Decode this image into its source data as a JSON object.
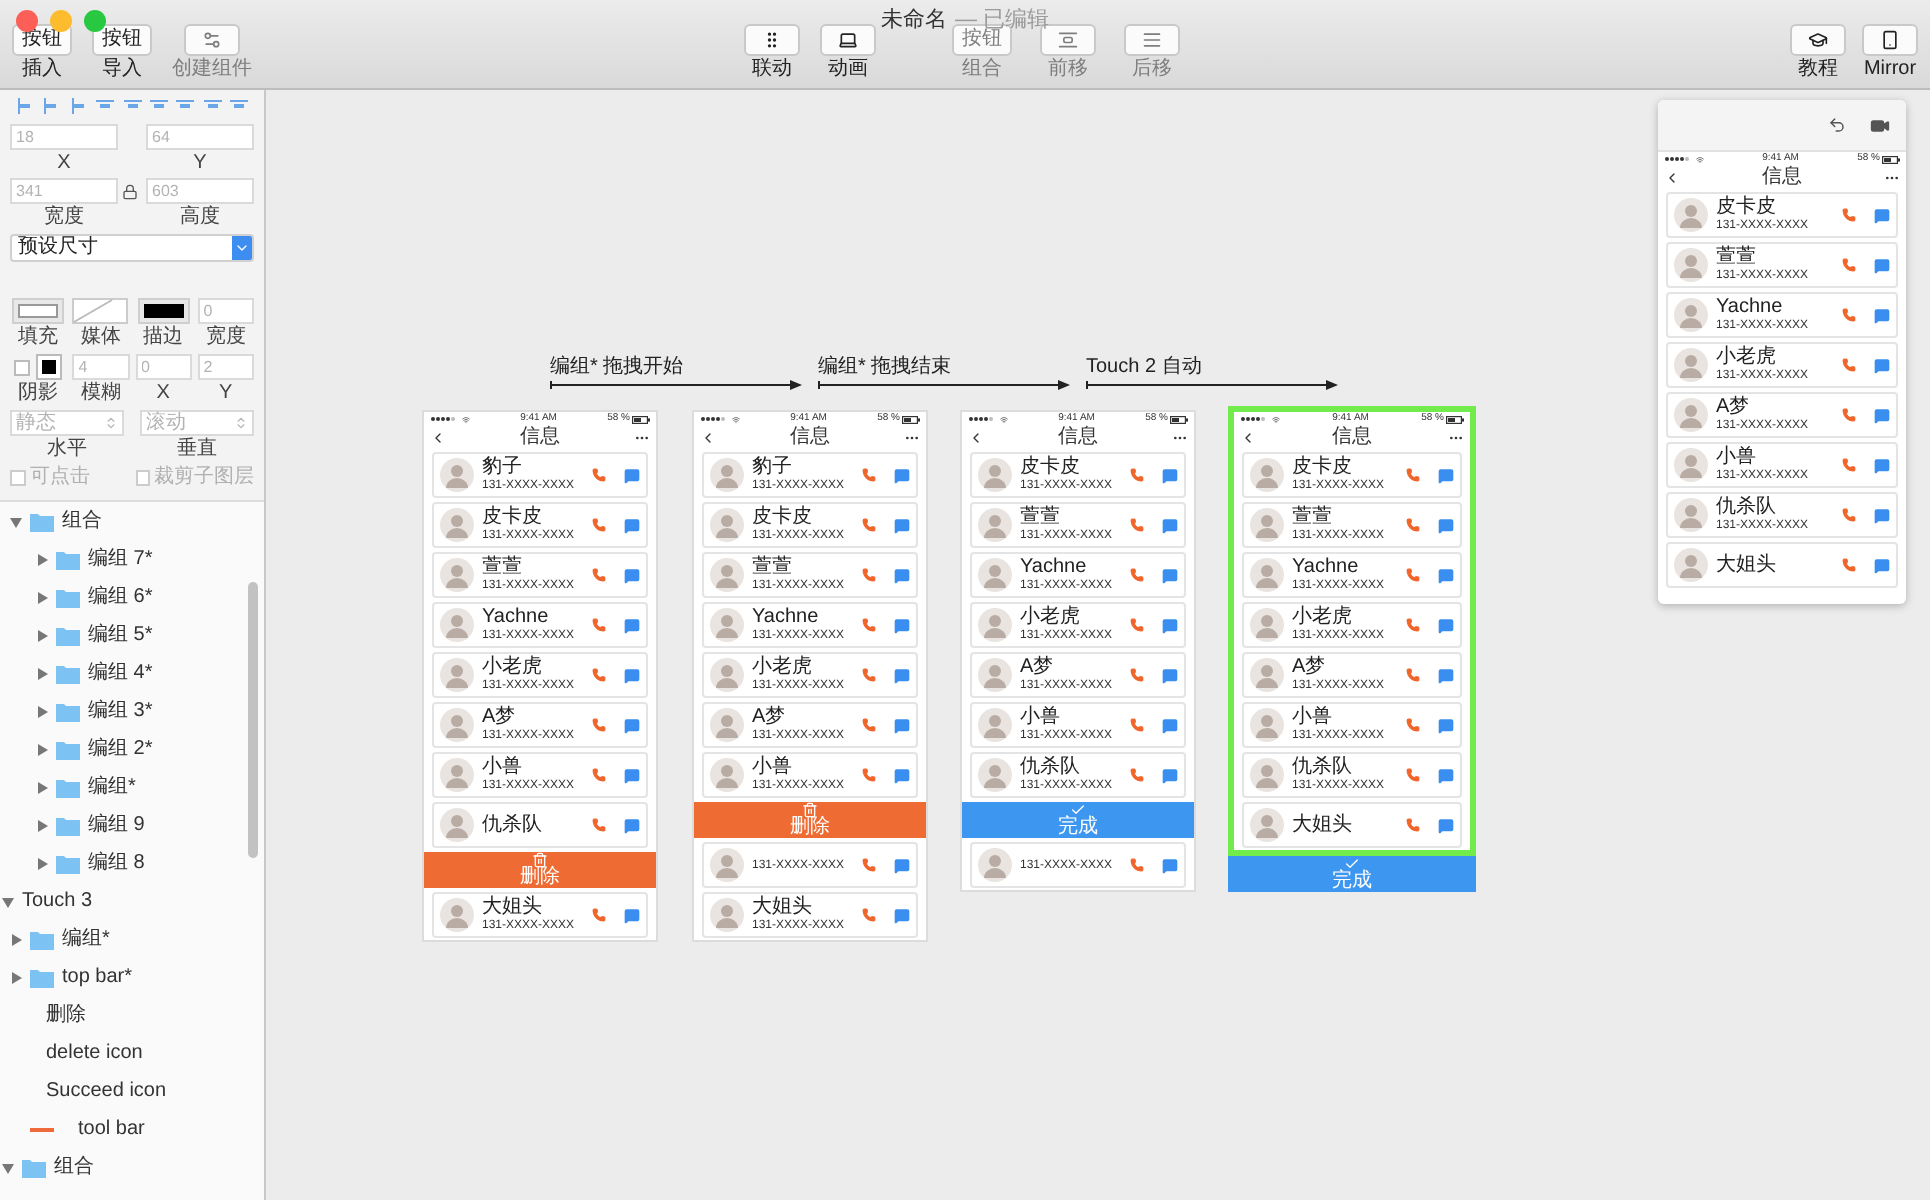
{
  "window": {
    "title": "未命名",
    "status": "— 已编辑"
  },
  "toolbar": {
    "left": [
      {
        "text": "按钮",
        "label": "插入",
        "disabled": false
      },
      {
        "text": "按钮",
        "label": "导入",
        "disabled": false
      },
      {
        "label": "创建组件",
        "disabled": true
      }
    ],
    "center": [
      {
        "label": "联动",
        "disabled": false
      },
      {
        "label": "动画",
        "disabled": false
      },
      {
        "text": "按钮",
        "label": "组合",
        "disabled": true
      },
      {
        "label": "前移",
        "disabled": true
      },
      {
        "label": "后移",
        "disabled": true
      }
    ],
    "right": [
      {
        "label": "教程",
        "disabled": false
      },
      {
        "label": "Mirror",
        "disabled": false
      }
    ]
  },
  "inspector": {
    "geometry": [
      {
        "value": "18",
        "label": "X"
      },
      {
        "value": "64",
        "label": "Y"
      },
      {
        "value": "341",
        "label": "宽度"
      },
      {
        "value": "603",
        "label": "高度"
      }
    ],
    "preset": "预设尺寸",
    "style_row": [
      {
        "kind": "fill",
        "label": "填充"
      },
      {
        "kind": "media",
        "label": "媒体"
      },
      {
        "kind": "stroke",
        "label": "描边"
      },
      {
        "kind": "number",
        "value": "0",
        "label": "宽度"
      }
    ],
    "shadow_row": [
      {
        "kind": "shadow",
        "label": "阴影",
        "checked": false
      },
      {
        "kind": "number",
        "value": "4",
        "label": "模糊"
      },
      {
        "kind": "number",
        "value": "0",
        "label": "X"
      },
      {
        "kind": "number",
        "value": "2",
        "label": "Y"
      }
    ],
    "position_row": [
      {
        "value": "静态",
        "label": "水平"
      },
      {
        "value": "滚动",
        "label": "垂直"
      }
    ],
    "options": [
      {
        "label": "可点击",
        "checked": false
      },
      {
        "label": "裁剪子图层",
        "checked": false
      }
    ]
  },
  "layers": [
    {
      "children": [
        {
          "label": "组合",
          "kind": "folder",
          "expanded": true,
          "children": [
            {
              "label": "编组 7*",
              "kind": "folder",
              "expanded": false
            },
            {
              "label": "编组 6*",
              "kind": "folder",
              "expanded": false
            },
            {
              "label": "编组 5*",
              "kind": "folder",
              "expanded": false
            },
            {
              "label": "编组 4*",
              "kind": "folder",
              "expanded": false
            },
            {
              "label": "编组 3*",
              "kind": "folder",
              "expanded": false
            },
            {
              "label": "编组 2*",
              "kind": "folder",
              "expanded": false
            },
            {
              "label": "编组*",
              "kind": "folder",
              "expanded": false
            },
            {
              "label": "编组 9",
              "kind": "folder",
              "expanded": false
            },
            {
              "label": "编组 8",
              "kind": "folder",
              "expanded": false
            }
          ]
        }
      ]
    },
    {
      "label": "Touch 3",
      "kind": "group",
      "expanded": true,
      "children": [
        {
          "label": "编组*",
          "kind": "folder",
          "expanded": false
        },
        {
          "label": "top bar*",
          "kind": "folder",
          "expanded": false
        },
        {
          "label": "删除",
          "kind": "text"
        },
        {
          "label": "delete icon",
          "kind": "text"
        },
        {
          "label": "Succeed icon",
          "kind": "text"
        },
        {
          "label": "tool bar",
          "kind": "line"
        }
      ]
    },
    {
      "label": "组合",
      "kind": "folder",
      "expanded": true
    }
  ],
  "transitions": [
    {
      "label": "编组* 拖拽开始"
    },
    {
      "label": "编组* 拖拽结束"
    },
    {
      "label": "Touch 2 自动"
    }
  ],
  "screens": [
    {
      "selected": false,
      "time": "9:41 AM",
      "battery": "58 %",
      "title": "信息",
      "items": [
        {
          "kind": "contact",
          "name": "豹子",
          "number": "131-XXXX-XXXX"
        },
        {
          "kind": "contact",
          "name": "皮卡皮",
          "number": "131-XXXX-XXXX"
        },
        {
          "kind": "contact",
          "name": "萱萱",
          "number": "131-XXXX-XXXX"
        },
        {
          "kind": "contact",
          "name": "Yachne",
          "number": "131-XXXX-XXXX"
        },
        {
          "kind": "contact",
          "name": "小老虎",
          "number": "131-XXXX-XXXX"
        },
        {
          "kind": "contact",
          "name": "A梦",
          "number": "131-XXXX-XXXX"
        },
        {
          "kind": "contact",
          "name": "小兽",
          "number": "131-XXXX-XXXX"
        },
        {
          "kind": "contact",
          "name": "仇杀队"
        },
        {
          "kind": "delete_bar",
          "label": "删除"
        },
        {
          "kind": "contact",
          "name": "大姐头",
          "number": "131-XXXX-XXXX"
        }
      ]
    },
    {
      "selected": false,
      "time": "9:41 AM",
      "battery": "58 %",
      "title": "信息",
      "items": [
        {
          "kind": "contact",
          "name": "豹子",
          "number": "131-XXXX-XXXX"
        },
        {
          "kind": "contact",
          "name": "皮卡皮",
          "number": "131-XXXX-XXXX"
        },
        {
          "kind": "contact",
          "name": "萱萱",
          "number": "131-XXXX-XXXX"
        },
        {
          "kind": "contact",
          "name": "Yachne",
          "number": "131-XXXX-XXXX"
        },
        {
          "kind": "contact",
          "name": "小老虎",
          "number": "131-XXXX-XXXX"
        },
        {
          "kind": "contact",
          "name": "A梦",
          "number": "131-XXXX-XXXX"
        },
        {
          "kind": "contact",
          "name": "小兽",
          "number": "131-XXXX-XXXX"
        },
        {
          "kind": "delete_bar",
          "label": "删除"
        },
        {
          "kind": "contact",
          "number": "131-XXXX-XXXX"
        },
        {
          "kind": "contact",
          "name": "大姐头",
          "number": "131-XXXX-XXXX"
        }
      ]
    },
    {
      "selected": false,
      "time": "9:41 AM",
      "battery": "58 %",
      "title": "信息",
      "items": [
        {
          "kind": "contact",
          "name": "皮卡皮",
          "number": "131-XXXX-XXXX"
        },
        {
          "kind": "contact",
          "name": "萱萱",
          "number": "131-XXXX-XXXX"
        },
        {
          "kind": "contact",
          "name": "Yachne",
          "number": "131-XXXX-XXXX"
        },
        {
          "kind": "contact",
          "name": "小老虎",
          "number": "131-XXXX-XXXX"
        },
        {
          "kind": "contact",
          "name": "A梦",
          "number": "131-XXXX-XXXX"
        },
        {
          "kind": "contact",
          "name": "小兽",
          "number": "131-XXXX-XXXX"
        },
        {
          "kind": "contact",
          "name": "仇杀队",
          "number": "131-XXXX-XXXX"
        },
        {
          "kind": "done_bar",
          "label": "完成"
        },
        {
          "kind": "contact",
          "number": "131-XXXX-XXXX"
        }
      ]
    },
    {
      "selected": true,
      "time": "9:41 AM",
      "battery": "58 %",
      "title": "信息",
      "items": [
        {
          "kind": "contact",
          "name": "皮卡皮",
          "number": "131-XXXX-XXXX"
        },
        {
          "kind": "contact",
          "name": "萱萱",
          "number": "131-XXXX-XXXX"
        },
        {
          "kind": "contact",
          "name": "Yachne",
          "number": "131-XXXX-XXXX"
        },
        {
          "kind": "contact",
          "name": "小老虎",
          "number": "131-XXXX-XXXX"
        },
        {
          "kind": "contact",
          "name": "A梦",
          "number": "131-XXXX-XXXX"
        },
        {
          "kind": "contact",
          "name": "小兽",
          "number": "131-XXXX-XXXX"
        },
        {
          "kind": "contact",
          "name": "仇杀队",
          "number": "131-XXXX-XXXX"
        },
        {
          "kind": "contact",
          "name": "大姐头"
        }
      ],
      "below": [
        {
          "kind": "done_bar",
          "label": "完成"
        }
      ]
    }
  ],
  "preview": {
    "time": "9:41 AM",
    "battery": "58 %",
    "title": "信息",
    "items": [
      {
        "kind": "contact",
        "name": "皮卡皮",
        "number": "131-XXXX-XXXX"
      },
      {
        "kind": "contact",
        "name": "萱萱",
        "number": "131-XXXX-XXXX"
      },
      {
        "kind": "contact",
        "name": "Yachne",
        "number": "131-XXXX-XXXX"
      },
      {
        "kind": "contact",
        "name": "小老虎",
        "number": "131-XXXX-XXXX"
      },
      {
        "kind": "contact",
        "name": "A梦",
        "number": "131-XXXX-XXXX"
      },
      {
        "kind": "contact",
        "name": "小兽",
        "number": "131-XXXX-XXXX"
      },
      {
        "kind": "contact",
        "name": "仇杀队",
        "number": "131-XXXX-XXXX"
      },
      {
        "kind": "contact",
        "name": "大姐头"
      }
    ]
  }
}
